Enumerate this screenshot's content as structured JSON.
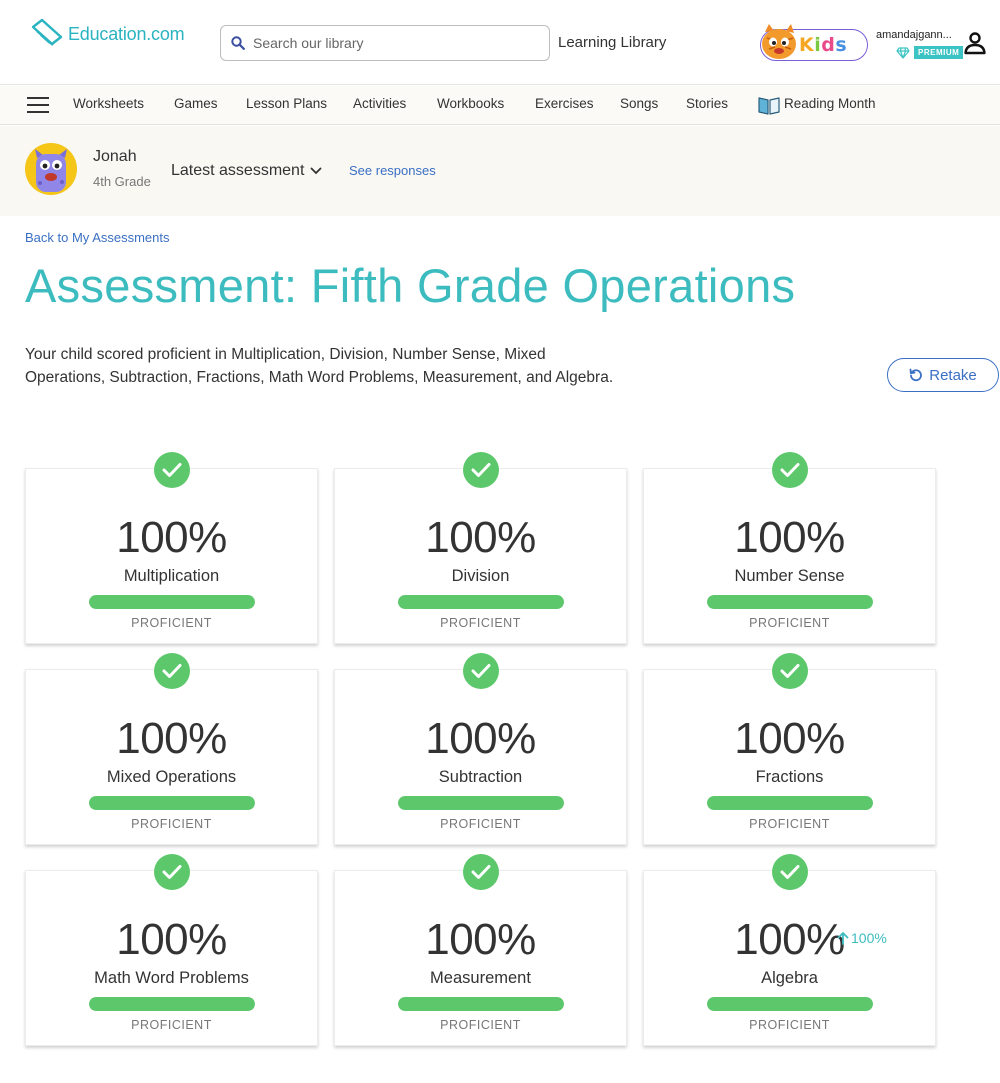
{
  "header": {
    "logo_text": "Education.com",
    "search_placeholder": "Search our library",
    "learning_library": "Learning Library",
    "kids_letters": [
      "K",
      "i",
      "d",
      "s"
    ],
    "user_name": "amandajgann...",
    "premium_label": "PREMIUM"
  },
  "nav": {
    "items": [
      "Worksheets",
      "Games",
      "Lesson Plans",
      "Activities",
      "Workbooks",
      "Exercises",
      "Songs",
      "Stories",
      "Reading Month"
    ]
  },
  "profile": {
    "child_name": "Jonah",
    "child_grade": "4th Grade",
    "latest_label": "Latest assessment",
    "see_responses": "See responses"
  },
  "page": {
    "back_link": "Back to My Assessments",
    "title": "Assessment: Fifth Grade Operations",
    "summary": "Your child scored proficient in Multiplication, Division, Number Sense, Mixed Operations, Subtraction, Fractions, Math Word Problems, Measurement, and Algebra.",
    "retake_label": "Retake"
  },
  "results": [
    {
      "score": "100%",
      "skill": "Multiplication",
      "level": "PROFICIENT",
      "progress": 1.0
    },
    {
      "score": "100%",
      "skill": "Division",
      "level": "PROFICIENT",
      "progress": 1.0
    },
    {
      "score": "100%",
      "skill": "Number Sense",
      "level": "PROFICIENT",
      "progress": 1.0
    },
    {
      "score": "100%",
      "skill": "Mixed Operations",
      "level": "PROFICIENT",
      "progress": 1.0
    },
    {
      "score": "100%",
      "skill": "Subtraction",
      "level": "PROFICIENT",
      "progress": 1.0
    },
    {
      "score": "100%",
      "skill": "Fractions",
      "level": "PROFICIENT",
      "progress": 1.0
    },
    {
      "score": "100%",
      "skill": "Math Word Problems",
      "level": "PROFICIENT",
      "progress": 1.0
    },
    {
      "score": "100%",
      "skill": "Measurement",
      "level": "PROFICIENT",
      "progress": 1.0
    },
    {
      "score": "100%",
      "skill": "Algebra",
      "level": "PROFICIENT",
      "progress": 1.0,
      "change": "100%"
    }
  ],
  "colors": {
    "accent": "#3cbcbf",
    "link": "#3a6fc4",
    "success": "#5cc86b"
  }
}
